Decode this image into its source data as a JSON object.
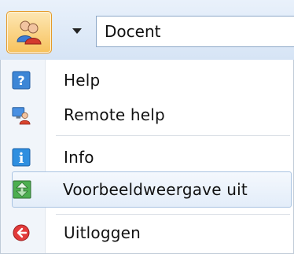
{
  "toolbar": {
    "user_icon": "users-icon",
    "dropdown_icon": "chevron-down-icon",
    "role_value": "Docent"
  },
  "menu": {
    "items": [
      {
        "label": "Help",
        "icon": "question-icon"
      },
      {
        "label": "Remote help",
        "icon": "remote-help-icon"
      },
      {
        "label": "Info",
        "icon": "info-icon"
      },
      {
        "label": "Voorbeeldweergave uit",
        "icon": "preview-toggle-icon",
        "selected": true
      },
      {
        "label": "Uitloggen",
        "icon": "logout-icon"
      }
    ]
  },
  "colors": {
    "accent_orange": "#f7c25c",
    "selection_border": "#a9c3e2",
    "help_blue": "#3d86d6",
    "logout_red": "#e23b3b"
  }
}
